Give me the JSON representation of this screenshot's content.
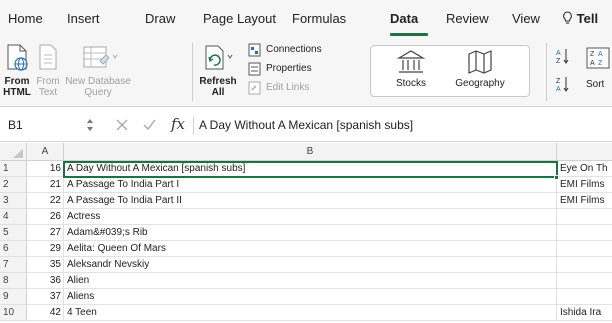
{
  "tabs": [
    "Home",
    "Insert",
    "Draw",
    "Page Layout",
    "Formulas",
    "Data",
    "Review",
    "View"
  ],
  "tell_me": "Tell",
  "ribbon": {
    "from_html": [
      "From",
      "HTML"
    ],
    "from_text": [
      "From",
      "Text"
    ],
    "new_database_query": [
      "New Database",
      "Query"
    ],
    "refresh_all": [
      "Refresh",
      "All"
    ],
    "connections": "Connections",
    "properties": "Properties",
    "edit_links": "Edit Links",
    "stocks": "Stocks",
    "geography": "Geography",
    "sort": "Sort"
  },
  "formula_bar": {
    "name_box": "B1",
    "fx": "fx",
    "content": "A Day Without A Mexican [spanish subs]"
  },
  "columns": [
    "A",
    "B"
  ],
  "rows": [
    {
      "num": "1",
      "a": "16",
      "b": "A Day Without A Mexican [spanish subs]",
      "c": "Eye On Th"
    },
    {
      "num": "2",
      "a": "21",
      "b": "A Passage To India Part I",
      "c": "EMI Films"
    },
    {
      "num": "3",
      "a": "22",
      "b": "A Passage To India Part II",
      "c": "EMI Films"
    },
    {
      "num": "4",
      "a": "26",
      "b": "Actress",
      "c": ""
    },
    {
      "num": "5",
      "a": "27",
      "b": "Adam&#039;s Rib",
      "c": ""
    },
    {
      "num": "6",
      "a": "29",
      "b": "Aelita: Queen Of Mars",
      "c": ""
    },
    {
      "num": "7",
      "a": "35",
      "b": "Aleksandr Nevskiy",
      "c": ""
    },
    {
      "num": "8",
      "a": "36",
      "b": "Alien",
      "c": ""
    },
    {
      "num": "9",
      "a": "37",
      "b": "Aliens",
      "c": ""
    },
    {
      "num": "10",
      "a": "42",
      "b": "4 Teen",
      "c": "Ishida Ira"
    }
  ],
  "colors": {
    "accent": "#1e7145"
  }
}
